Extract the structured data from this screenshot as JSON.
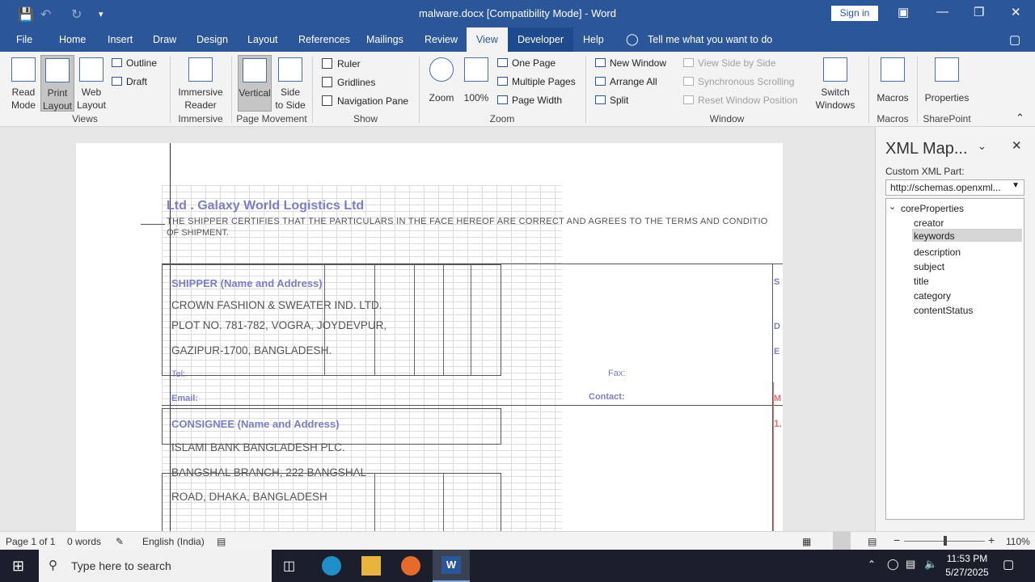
{
  "app": {
    "title": "malware.docx [Compatibility Mode]  -  Word",
    "sign_in": "Sign in"
  },
  "tabs": [
    "File",
    "Home",
    "Insert",
    "Draw",
    "Design",
    "Layout",
    "References",
    "Mailings",
    "Review",
    "View",
    "Developer",
    "Help"
  ],
  "tell_me": "Tell me what you want to do",
  "ribbon": {
    "views": {
      "read_mode": "Read\nMode",
      "print_layout": "Print\nLayout",
      "web_layout": "Web\nLayout",
      "outline": "Outline",
      "draft": "Draft",
      "label": "Views"
    },
    "immersive": {
      "reader": "Immersive\nReader",
      "label": "Immersive"
    },
    "page_movement": {
      "vertical": "Vertical",
      "side": "Side\nto Side",
      "label": "Page Movement"
    },
    "show": {
      "ruler": "Ruler",
      "gridlines": "Gridlines",
      "nav_pane": "Navigation Pane",
      "label": "Show"
    },
    "zoom": {
      "zoom": "Zoom",
      "hundred": "100%",
      "one_page": "One Page",
      "multiple_pages": "Multiple Pages",
      "page_width": "Page Width",
      "label": "Zoom"
    },
    "window": {
      "new_window": "New Window",
      "arrange_all": "Arrange All",
      "split": "Split",
      "view_side": "View Side by Side",
      "sync_scroll": "Synchronous Scrolling",
      "reset_pos": "Reset Window Position",
      "switch": "Switch\nWindows",
      "label": "Window"
    },
    "macros": {
      "macros": "Macros",
      "label": "Macros"
    },
    "sharepoint": {
      "properties": "Properties",
      "label": "SharePoint"
    }
  },
  "document": {
    "company": "Ltd . Galaxy World Logistics Ltd",
    "certify": "THE SHIPPER CERTIFIES THAT THE PARTICULARS IN THE FACE HEREOF ARE CORRECT AND AGREES TO THE TERMS AND CONDITIO",
    "certify2": "OF SHIPMENT.",
    "shipper_label": "SHIPPER (Name and Address)",
    "shipper1": "CROWN FASHION & SWEATER IND. LTD.",
    "shipper2": "PLOT NO. 781-782, VOGRA, JOYDEVPUR,",
    "shipper3": "GAZIPUR-1700, BANGLADESH.",
    "tel": "Tel:",
    "fax": "Fax:",
    "email": "Email:",
    "contact": "Contact:",
    "consignee_label": "CONSIGNEE (Name and Address)",
    "consignee1": "ISLAMI BANK BANGLADESH PLC.",
    "consignee2": "BANGSHAL BRANCH, 222 BANGSHAL",
    "consignee3": "ROAD, DHAKA, BANGLADESH",
    "right_s": "S",
    "right_d": "D",
    "right_e": "E",
    "right_m": "M",
    "right_1": "1."
  },
  "xml_pane": {
    "title": "XML Map...",
    "custom_label": "Custom XML Part:",
    "custom_value": "http://schemas.openxml...",
    "root": "coreProperties",
    "nodes": [
      "creator",
      "keywords",
      "description",
      "subject",
      "title",
      "category",
      "contentStatus"
    ],
    "selected": "keywords"
  },
  "status": {
    "page": "Page 1 of 1",
    "words": "0 words",
    "language": "English (India)",
    "zoom": "110%",
    "zoom_level_pct": 110
  },
  "taskbar": {
    "search": "Type here to search",
    "time": "11:53 PM",
    "date": "5/27/2025"
  }
}
